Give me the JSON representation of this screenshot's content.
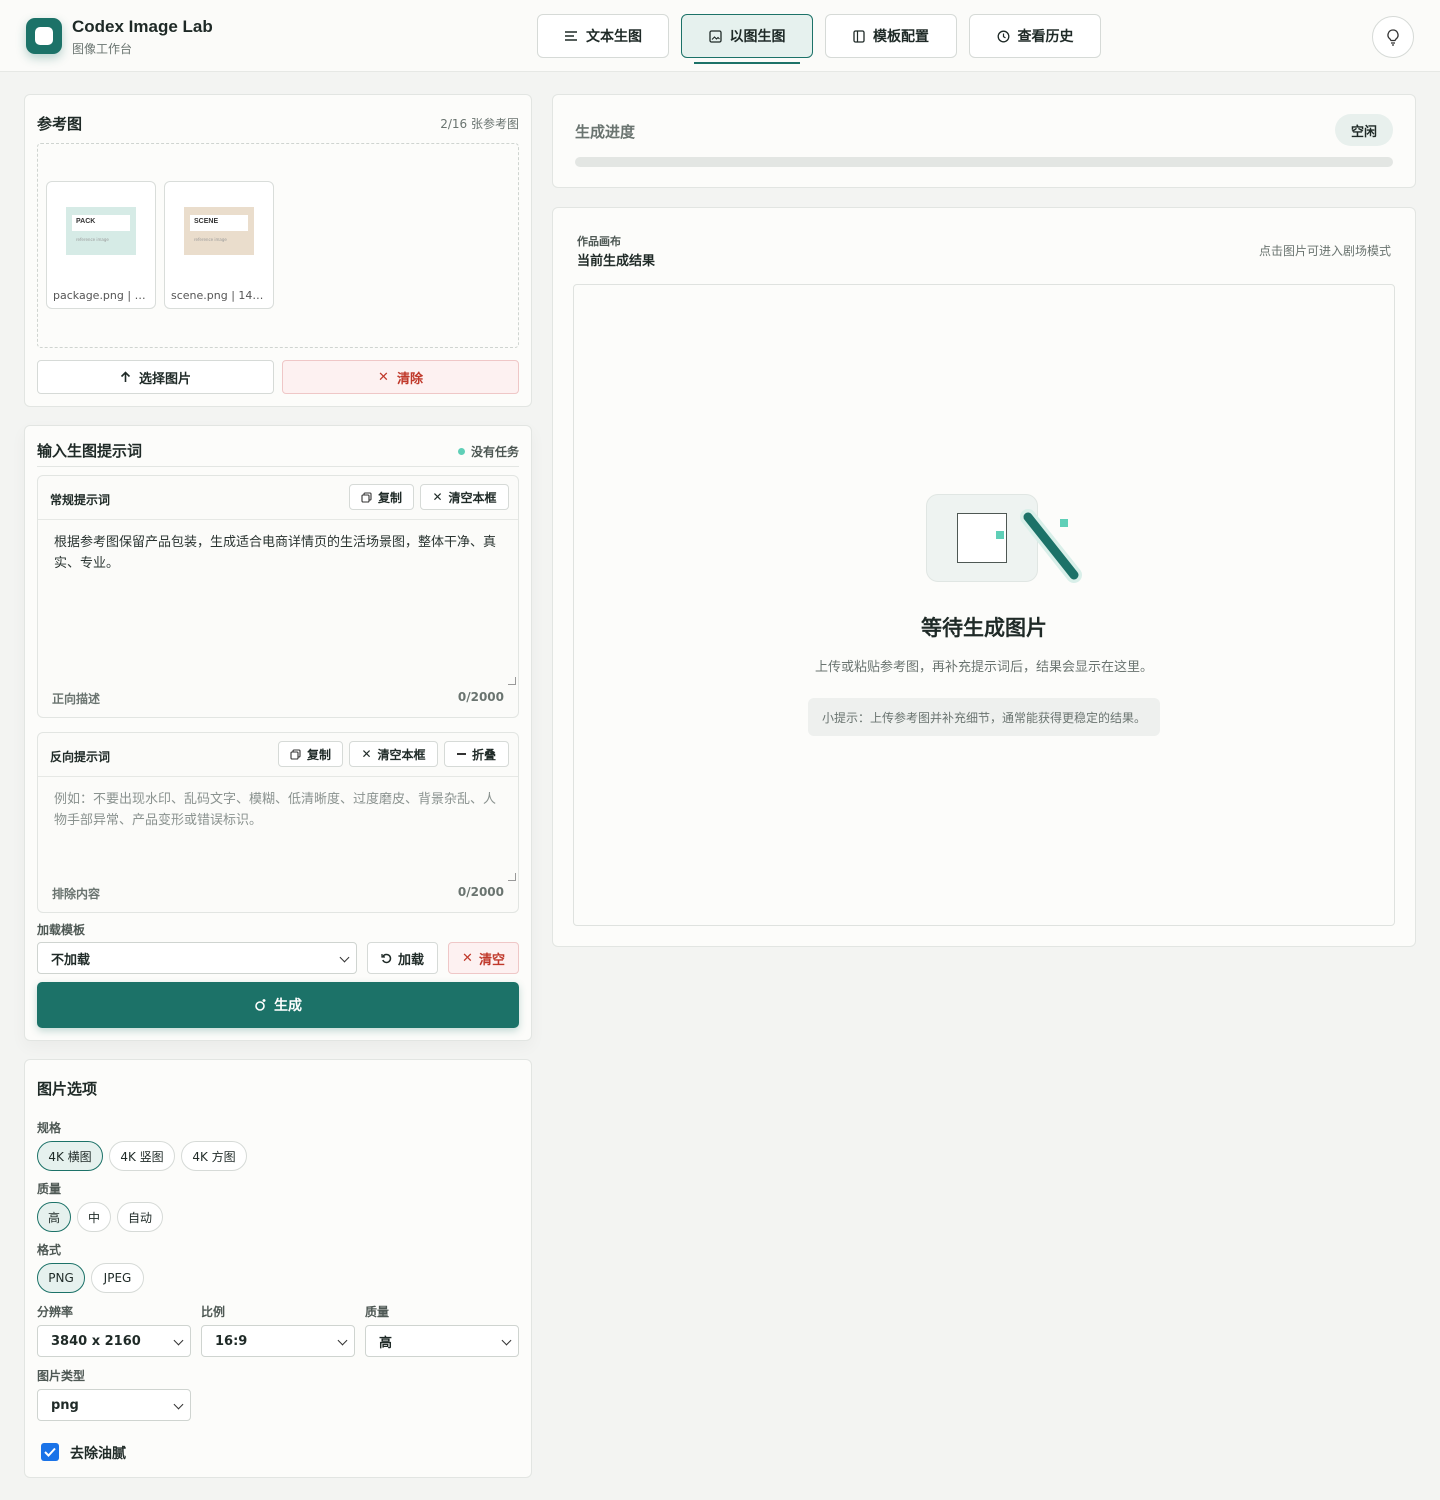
{
  "brand": {
    "title": "Codex Image Lab",
    "subtitle": "图像工作台"
  },
  "nav": {
    "tabs": [
      {
        "label": "文本生图",
        "icon": "list-icon"
      },
      {
        "label": "以图生图",
        "icon": "image-icon",
        "active": true
      },
      {
        "label": "模板配置",
        "icon": "template-icon"
      },
      {
        "label": "查看历史",
        "icon": "clock-icon"
      }
    ],
    "help_icon": "help-bulb-icon"
  },
  "reference": {
    "title": "参考图",
    "count": "2/16 张参考图",
    "images": [
      {
        "thumb_label": "PACK",
        "thumb_sub": "reference image",
        "caption": "package.png | 1...",
        "bg": "#d6ebe6"
      },
      {
        "thumb_label": "SCENE",
        "thumb_sub": "reference image",
        "caption": "scene.png | 140...",
        "bg": "#eaddcc"
      }
    ],
    "select_label": "选择图片",
    "clear_label": "清除"
  },
  "prompt": {
    "title": "输入生图提示词",
    "status": "没有任务",
    "positive": {
      "label": "常规提示词",
      "copy_label": "复制",
      "clear_label": "清空本框",
      "text": "根据参考图保留产品包装，生成适合电商详情页的生活场景图，整体干净、真实、专业。",
      "footer": "正向描述",
      "counter": "0/2000"
    },
    "negative": {
      "label": "反向提示词",
      "copy_label": "复制",
      "clear_label": "清空本框",
      "collapse_label": "折叠",
      "placeholder": "例如：不要出现水印、乱码文字、模糊、低清晰度、过度磨皮、背景杂乱、人物手部异常、产品变形或错误标识。",
      "footer": "排除内容",
      "counter": "0/2000"
    },
    "template": {
      "label": "加载模板",
      "selected": "不加载",
      "load_label": "加载",
      "clear_label": "清空"
    },
    "generate_label": "生成"
  },
  "options": {
    "title": "图片选项",
    "spec": {
      "label": "规格",
      "items": [
        "4K 横图",
        "4K 竖图",
        "4K 方图"
      ],
      "active": 0
    },
    "quality": {
      "label": "质量",
      "items": [
        "高",
        "中",
        "自动"
      ],
      "active": 0
    },
    "format": {
      "label": "格式",
      "items": [
        "PNG",
        "JPEG"
      ],
      "active": 0
    },
    "resolution": {
      "label": "分辨率",
      "value": "3840 x 2160"
    },
    "ratio": {
      "label": "比例",
      "value": "16:9"
    },
    "quality_select": {
      "label": "质量",
      "value": "高"
    },
    "image_type": {
      "label": "图片类型",
      "value": "png"
    },
    "remove_grease": {
      "label": "去除油腻",
      "checked": true
    }
  },
  "progress": {
    "title": "生成进度",
    "status": "空闲",
    "percent": 0
  },
  "canvas": {
    "eyebrow": "作品画布",
    "title": "当前生成结果",
    "hint": "点击图片可进入剧场模式",
    "empty_title": "等待生成图片",
    "empty_desc": "上传或粘贴参考图，再补充提示词后，结果会显示在这里。",
    "tip": "小提示：上传参考图并补充细节，通常能获得更稳定的结果。"
  },
  "colors": {
    "accent": "#1c7268",
    "accent_light": "#e6f1ee",
    "danger": "#c0392b",
    "mint": "#5fcfb7"
  }
}
